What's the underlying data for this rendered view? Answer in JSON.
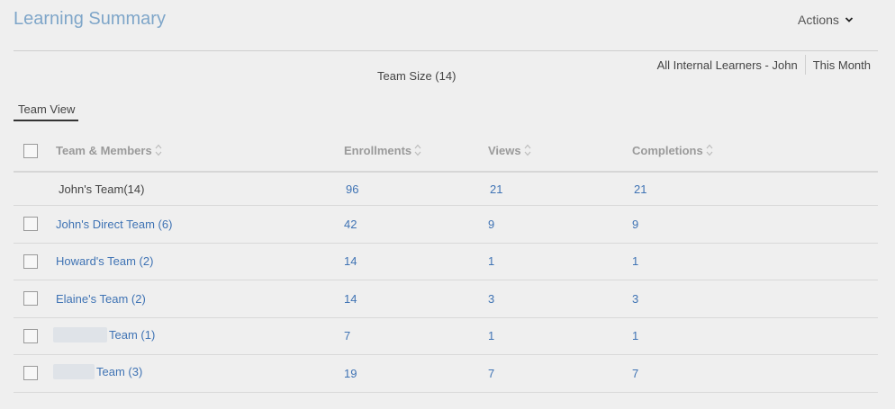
{
  "header": {
    "title": "Learning Summary",
    "actions_label": "Actions"
  },
  "filters": {
    "scope": "All Internal Learners - John",
    "period": "This Month"
  },
  "team_size": "Team Size (14)",
  "tabs": [
    {
      "label": "Team View",
      "active": true
    }
  ],
  "table": {
    "columns": [
      "Team & Members",
      "Enrollments",
      "Views",
      "Completions"
    ],
    "summary": {
      "name": "John's Team(14)",
      "enrollments": "96",
      "views": "21",
      "completions": "21"
    },
    "rows": [
      {
        "name": "John's Direct Team (6)",
        "enrollments": "42",
        "views": "9",
        "completions": "9",
        "redacted": false
      },
      {
        "name": "Howard's Team (2)",
        "enrollments": "14",
        "views": "1",
        "completions": "1",
        "redacted": false
      },
      {
        "name": "Elaine's Team (2)",
        "enrollments": "14",
        "views": "3",
        "completions": "3",
        "redacted": false
      },
      {
        "name": "Team (1)",
        "enrollments": "7",
        "views": "1",
        "completions": "1",
        "redacted": true
      },
      {
        "name": "Team (3)",
        "enrollments": "19",
        "views": "7",
        "completions": "7",
        "redacted": true
      }
    ]
  },
  "icons": {
    "actions": "chevron-down-icon",
    "sort": "sort-icon"
  },
  "colors": {
    "title": "#7fa6c9",
    "link": "#3f73b4",
    "background": "#efefef"
  }
}
